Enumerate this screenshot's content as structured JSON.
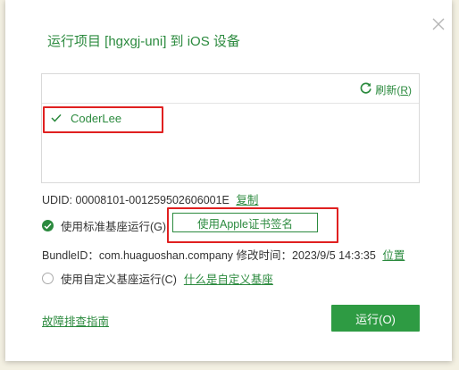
{
  "dialog": {
    "title": "运行项目 [hgxgj-uni] 到 iOS 设备",
    "close_icon": "close-icon"
  },
  "devices": {
    "refresh_label": "刷新(R)",
    "refresh_text": "刷新(",
    "refresh_key": "R",
    "refresh_close": ")",
    "items": [
      {
        "name": "CoderLee",
        "checked": true
      }
    ]
  },
  "udid": {
    "label": "UDID: 00008101-001259502606001E",
    "copy_label": "复制"
  },
  "base": {
    "standard_label": "使用标准基座运行(G)",
    "apple_sign_label": "使用Apple证书签名",
    "bundle_text": "BundleID：com.huaguoshan.company  修改时间：2023/9/5 14:3:35",
    "location_label": "位置",
    "custom_label": "使用自定义基座运行(C)",
    "what_is_custom_label": "什么是自定义基座"
  },
  "footer": {
    "troubleshoot_label": "故障排查指南",
    "run_label": "运行(O)"
  },
  "colors": {
    "accent": "#2b8a3e",
    "primary_button": "#2e9b43",
    "highlight": "#e02020"
  }
}
